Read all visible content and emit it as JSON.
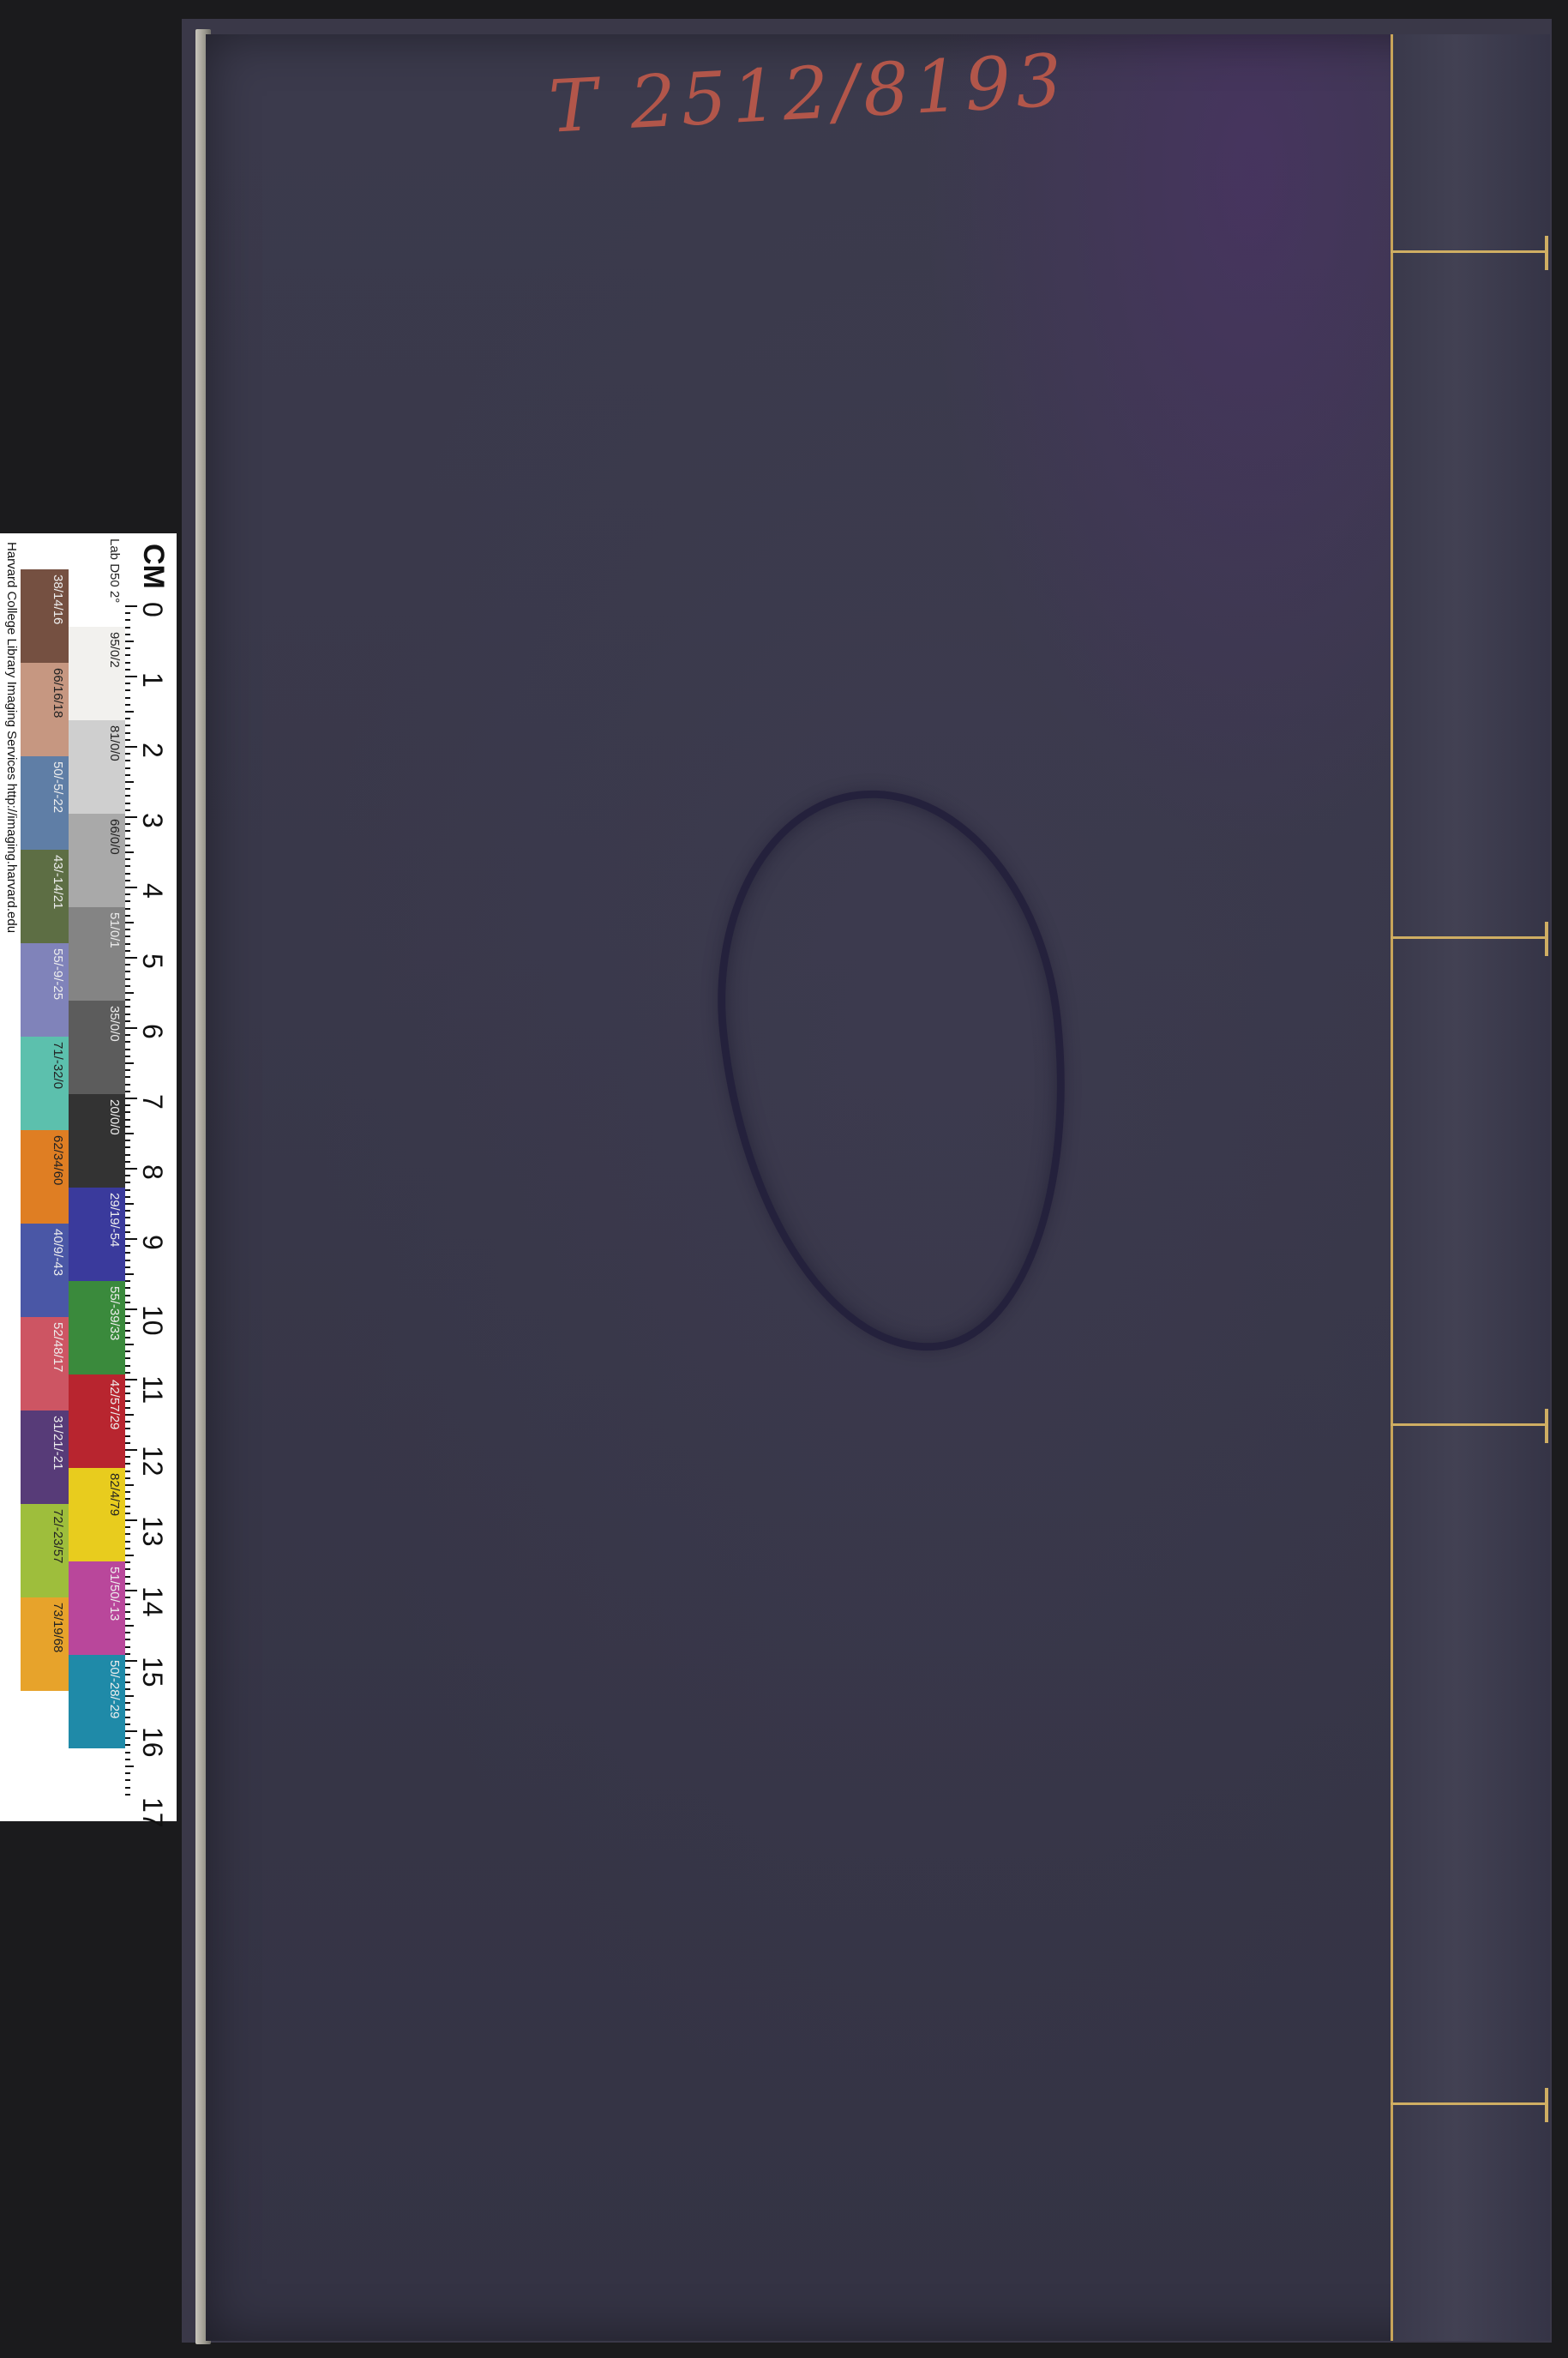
{
  "cover": {
    "call_number": "T 2512/8193",
    "cloth_color": "#3a3848",
    "thread_color": "#cfae63"
  },
  "color_target": {
    "ruler_label": "CM",
    "cm_marks": [
      "0",
      "1",
      "2",
      "3",
      "4",
      "5",
      "6",
      "7",
      "8",
      "9",
      "10",
      "11",
      "12",
      "13",
      "14",
      "15",
      "16",
      "17"
    ],
    "grey_row": [
      {
        "label": "Lab D50 2°",
        "color": "#ffffff"
      },
      {
        "label": "95/0/2",
        "color": "#f2f1ee"
      },
      {
        "label": "81/0/0",
        "color": "#cfcfcf"
      },
      {
        "label": "66/0/0",
        "color": "#a9a9a9"
      },
      {
        "label": "51/0/1",
        "color": "#848484"
      },
      {
        "label": "35/0/0",
        "color": "#5c5c5c"
      },
      {
        "label": "20/0/0",
        "color": "#333333"
      },
      {
        "label": "29/19/-54",
        "color": "#3a3a9c"
      },
      {
        "label": "55/-39/33",
        "color": "#3a8a3c"
      },
      {
        "label": "42/57/29",
        "color": "#b8252f"
      },
      {
        "label": "82/4/79",
        "color": "#e8cc1e"
      },
      {
        "label": "51/50/-13",
        "color": "#b9479b"
      },
      {
        "label": "50/-28/-29",
        "color": "#1f8aa8"
      }
    ],
    "color_row": [
      {
        "label": "38/14/16",
        "color": "#755041"
      },
      {
        "label": "66/16/18",
        "color": "#c69781"
      },
      {
        "label": "50/-5/-22",
        "color": "#5f7ea6"
      },
      {
        "label": "43/-14/21",
        "color": "#5d6e44"
      },
      {
        "label": "55/-9/-25",
        "color": "#8083ba"
      },
      {
        "label": "71/-32/0",
        "color": "#5cc0ad"
      },
      {
        "label": "62/34/60",
        "color": "#df7e23"
      },
      {
        "label": "40/9/-43",
        "color": "#4a57a6"
      },
      {
        "label": "52/48/17",
        "color": "#cd5563"
      },
      {
        "label": "31/21/-21",
        "color": "#573b78"
      },
      {
        "label": "72/-23/57",
        "color": "#9ebe3c"
      },
      {
        "label": "73/19/68",
        "color": "#e7a32b"
      }
    ],
    "credit": "Harvard College Library Imaging Services http://imaging.harvard.edu"
  }
}
